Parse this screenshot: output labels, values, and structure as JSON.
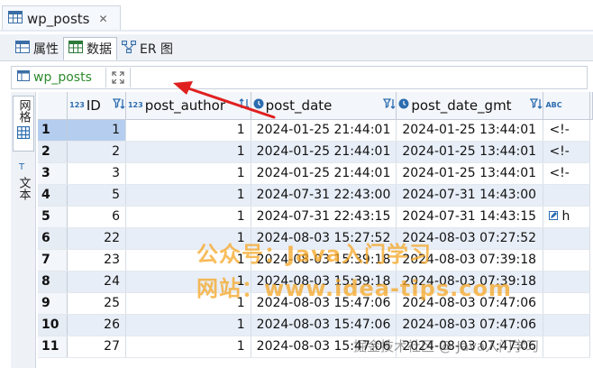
{
  "document_tab": {
    "title": "wp_posts",
    "close_glyph": "✕",
    "icon": "table-icon"
  },
  "editor_tabs": [
    {
      "label": "属性",
      "icon": "properties-icon",
      "active": false
    },
    {
      "label": "数据",
      "icon": "data-icon",
      "active": true
    },
    {
      "label": "ER 图",
      "icon": "er-diagram-icon",
      "active": false
    }
  ],
  "filter_bar": {
    "entity": "wp_posts",
    "filter_value": ""
  },
  "side_panel": {
    "grid_label": "网格",
    "text_label": "文本"
  },
  "columns": [
    {
      "name": "ID",
      "type_badge": "123",
      "kind": "num"
    },
    {
      "name": "post_author",
      "type_badge": "123",
      "kind": "num"
    },
    {
      "name": "post_date",
      "type_badge": "clock",
      "kind": "txt"
    },
    {
      "name": "post_date_gmt",
      "type_badge": "clock",
      "kind": "txt"
    },
    {
      "name": "",
      "type_badge": "ABC",
      "kind": "txt"
    }
  ],
  "rows": [
    {
      "n": "1",
      "id": "1",
      "author": "1",
      "date": "2024-01-25 21:44:01",
      "gmt": "2024-01-25 13:44:01",
      "extra": "<!-"
    },
    {
      "n": "2",
      "id": "2",
      "author": "1",
      "date": "2024-01-25 21:44:01",
      "gmt": "2024-01-25 13:44:01",
      "extra": "<!-"
    },
    {
      "n": "3",
      "id": "3",
      "author": "1",
      "date": "2024-01-25 21:44:01",
      "gmt": "2024-01-25 13:44:01",
      "extra": "<!-"
    },
    {
      "n": "4",
      "id": "5",
      "author": "1",
      "date": "2024-07-31 22:43:00",
      "gmt": "2024-07-31 14:43:00",
      "extra": ""
    },
    {
      "n": "5",
      "id": "6",
      "author": "1",
      "date": "2024-07-31 22:43:15",
      "gmt": "2024-07-31 14:43:15",
      "extra": "h"
    },
    {
      "n": "6",
      "id": "22",
      "author": "1",
      "date": "2024-08-03 15:27:52",
      "gmt": "2024-08-03 07:27:52",
      "extra": ""
    },
    {
      "n": "7",
      "id": "23",
      "author": "1",
      "date": "2024-08-03 15:39:18",
      "gmt": "2024-08-03 07:39:18",
      "extra": ""
    },
    {
      "n": "8",
      "id": "24",
      "author": "1",
      "date": "2024-08-03 15:39:18",
      "gmt": "2024-08-03 07:39:18",
      "extra": ""
    },
    {
      "n": "9",
      "id": "25",
      "author": "1",
      "date": "2024-08-03 15:47:06",
      "gmt": "2024-08-03 07:47:06",
      "extra": ""
    },
    {
      "n": "10",
      "id": "26",
      "author": "1",
      "date": "2024-08-03 15:47:06",
      "gmt": "2024-08-03 07:47:06",
      "extra": ""
    },
    {
      "n": "11",
      "id": "27",
      "author": "1",
      "date": "2024-08-03 15:47:06",
      "gmt": "2024-08-03 07:47:06",
      "extra": ""
    }
  ],
  "watermark": {
    "line1": "公众号：Java入门学习",
    "line2": "网站：www.idea-tips.com",
    "line3": "掘金技术社区 @ Java入门学习"
  },
  "colors": {
    "accent": "#2d8b2d",
    "selection": "#b5cef0",
    "arrow": "#e02020",
    "watermark": "#f5a623"
  }
}
